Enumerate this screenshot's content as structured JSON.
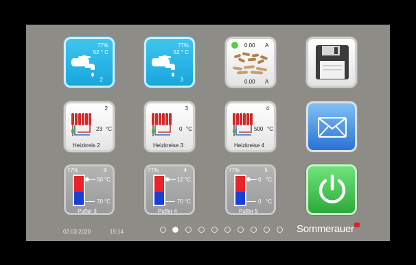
{
  "tiles": {
    "hot_water_1": {
      "percent": "77%",
      "temp": "52 ° C",
      "num": "2"
    },
    "hot_water_2": {
      "percent": "77%",
      "temp": "52 ° C",
      "num": "3"
    },
    "pellets": {
      "top_value": "0.00",
      "top_unit": "A",
      "bottom_value": "0.00",
      "bottom_unit": "A"
    },
    "heating_circuits": [
      {
        "num": "2",
        "temp": "23",
        "unit": "°C",
        "label": "Heizkreis 2"
      },
      {
        "num": "3",
        "temp": "0",
        "unit": "°C",
        "label": "Heizkreise 3"
      },
      {
        "num": "4",
        "temp": "500",
        "unit": "°C",
        "label": "Heizkreise 4"
      }
    ],
    "buffers": [
      {
        "percent": "77%",
        "num": "3",
        "top_temp": "50",
        "top_unit": "°C",
        "bottom_temp": "70",
        "bottom_unit": "°C",
        "label": "Puffer 3",
        "fill_top": 0.55
      },
      {
        "percent": "77%",
        "num": "4",
        "top_temp": "12",
        "top_unit": "°C",
        "bottom_temp": "70",
        "bottom_unit": "°C",
        "label": "Puffer 4",
        "fill_top": 0.55
      },
      {
        "percent": "77%",
        "num": "5",
        "top_temp": "0",
        "top_unit": "°C",
        "bottom_temp": "0",
        "bottom_unit": "°C",
        "label": "Puffer 5",
        "fill_top": 0.55
      }
    ]
  },
  "footer": {
    "date": "02.03.2020",
    "time": "15:14",
    "brand": "Sommerauer",
    "active_page": 2,
    "page_count": 10
  },
  "colors": {
    "screen_bg": "#8e8c87",
    "tile_blue": "#19a6dc",
    "power_green": "#2daa3c",
    "buffer_hot": "#e8232a",
    "buffer_cold": "#1a3fd6"
  }
}
